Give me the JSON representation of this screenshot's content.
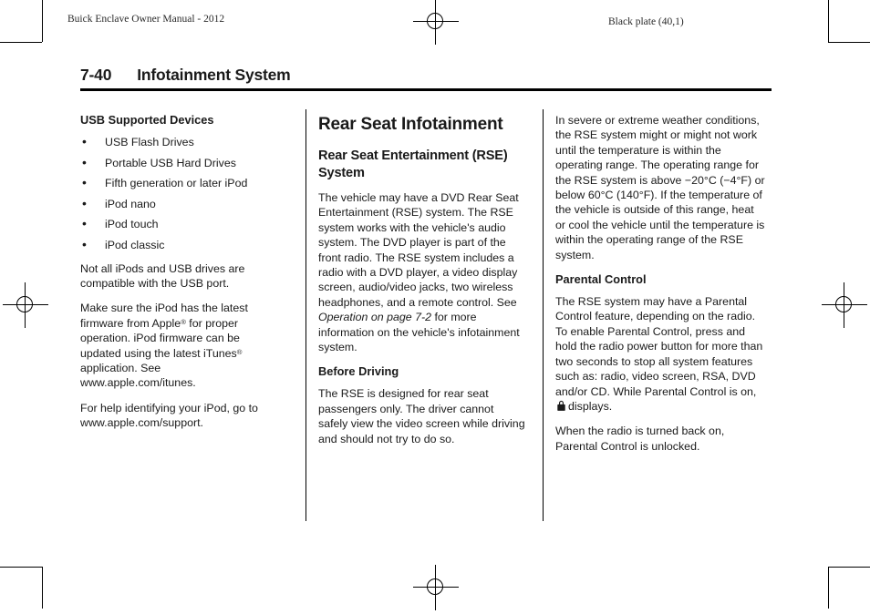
{
  "running_head": {
    "left": "Buick Enclave Owner Manual - 2012",
    "right": "Black plate (40,1)"
  },
  "page_title": {
    "folio": "7-40",
    "title": "Infotainment System"
  },
  "column_1": {
    "heading": "USB Supported Devices",
    "bullet_marker": "•",
    "bullets": [
      "USB Flash Drives",
      "Portable USB Hard Drives",
      "Fifth generation or later iPod",
      "iPod nano",
      "iPod touch",
      "iPod classic"
    ],
    "para_1": "Not all iPods and USB drives are compatible with the USB port.",
    "para_2_a": "Make sure the iPod has the latest firmware from Apple",
    "para_2_reg_1": "®",
    "para_2_b": " for proper operation. iPod firmware can be updated using the latest iTunes",
    "para_2_reg_2": "®",
    "para_2_c": " application. See www.apple.com/itunes.",
    "para_3": "For help identifying your iPod, go to www.apple.com/support."
  },
  "column_2": {
    "section_heading": "Rear Seat Infotainment",
    "sub_heading": "Rear Seat Entertainment (RSE) System",
    "para_1_a": "The vehicle may have a DVD Rear Seat Entertainment (RSE) system. The RSE system works with the vehicle's audio system. The DVD player is part of the front radio. The RSE system includes a radio with a DVD player, a video display screen, audio/video jacks, two wireless headphones, and a remote control. See ",
    "para_1_xref": "Operation on page 7‑2",
    "para_1_b": " for more information on the vehicle's infotainment system.",
    "before_driving_heading": "Before Driving",
    "before_driving_para": "The RSE is designed for rear seat passengers only. The driver cannot safely view the video screen while driving and should not try to do so."
  },
  "column_3": {
    "para_1": "In severe or extreme weather conditions, the RSE system might or might not work until the temperature is within the operating range. The operating range for the RSE system is above −20°C (−4°F) or below 60°C (140°F). If the temperature of the vehicle is outside of this range, heat or cool the vehicle until the temperature is within the operating range of the RSE system.",
    "parental_control_heading": "Parental Control",
    "parental_para_a": "The RSE system may have a Parental Control feature, depending on the radio. To enable Parental Control, press and hold the radio power button for more than two seconds to stop all system features such as: radio, video screen, RSA, DVD and/or CD. While Parental Control is on,",
    "parental_icon": "lock-icon",
    "parental_para_b": "displays.",
    "parental_para_2": "When the radio is turned back on, Parental Control is unlocked."
  }
}
